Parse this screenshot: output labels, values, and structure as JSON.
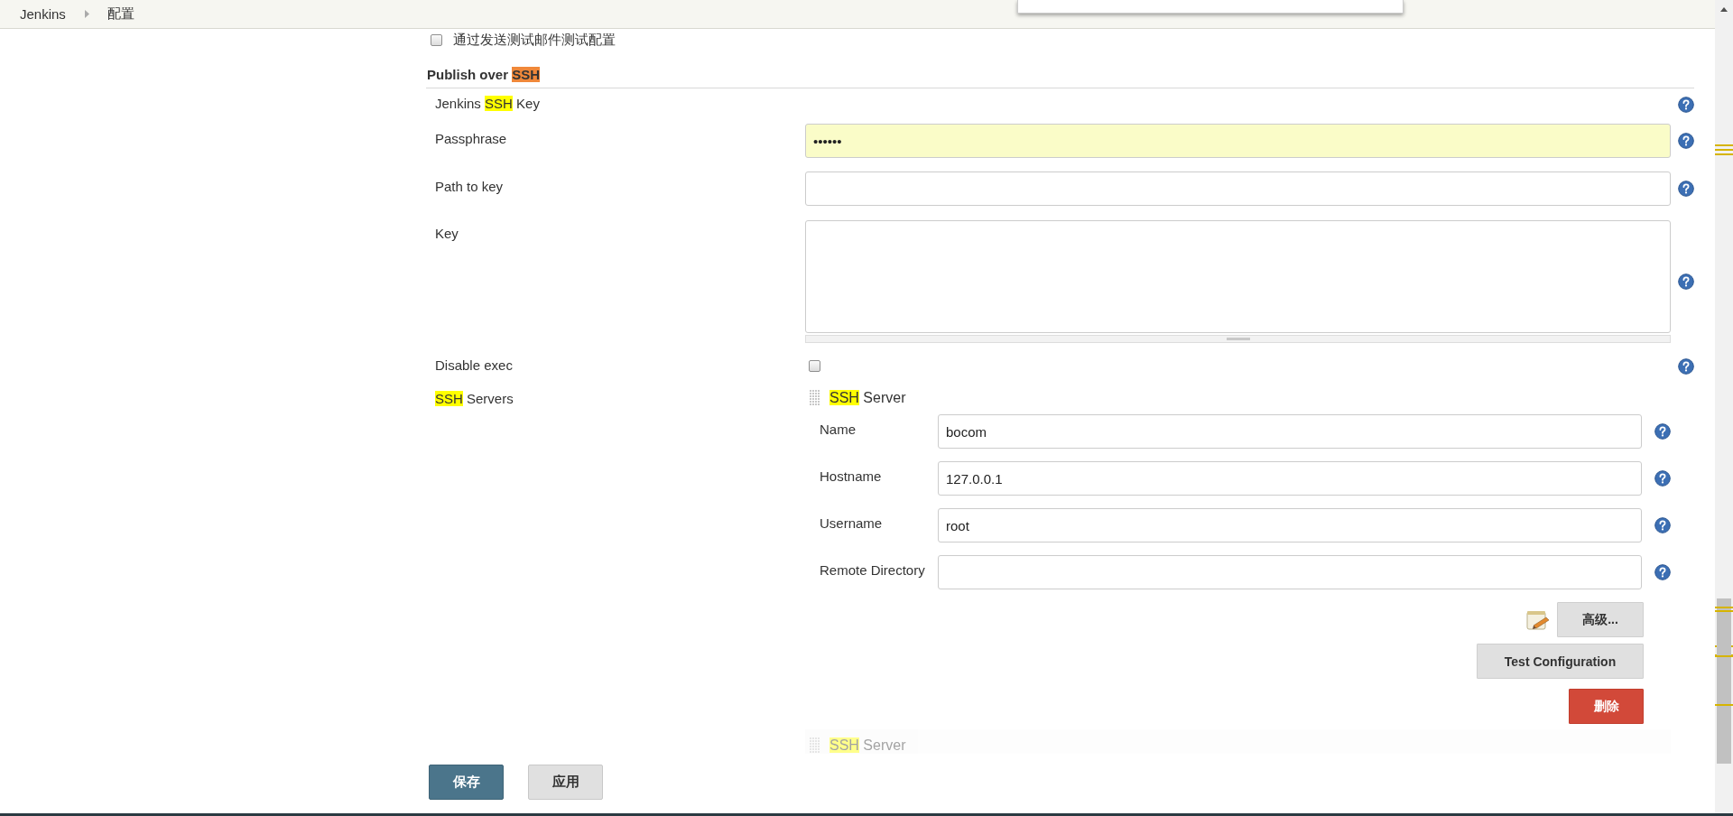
{
  "breadcrumbs": [
    {
      "label": "Jenkins"
    },
    {
      "label": "配置"
    }
  ],
  "test_mail": {
    "label": "通过发送测试邮件测试配置",
    "checked": false
  },
  "section": {
    "title": [
      {
        "text": "Publish over "
      },
      {
        "text": "SSH",
        "highlighted": true,
        "active": true
      }
    ]
  },
  "fields": [
    {
      "kind": "label",
      "label": [
        {
          "text": "Jenkins "
        },
        {
          "text": "SSH",
          "highlighted": true,
          "active": false
        },
        {
          "text": " Key"
        }
      ]
    },
    {
      "kind": "password",
      "label": [
        {
          "text": "Passphrase"
        }
      ],
      "value": "••••••",
      "autofilled": true
    },
    {
      "kind": "text",
      "label": [
        {
          "text": "Path to key"
        }
      ]
    },
    {
      "kind": "textarea",
      "label": [
        {
          "text": "Key"
        }
      ]
    },
    {
      "kind": "checkbox",
      "label": [
        {
          "text": "Disable exec"
        }
      ],
      "checked": false
    }
  ],
  "ssh_servers": {
    "label": [
      {
        "text": "SSH",
        "highlighted": true,
        "active": false
      },
      {
        "text": " Servers"
      }
    ],
    "servers": [
      {
        "title": [
          {
            "text": "SSH",
            "highlighted": true,
            "active": false
          },
          {
            "text": " Server"
          }
        ],
        "dimmed": false,
        "fields": [
          {
            "label": "Name",
            "value": "bocom"
          },
          {
            "label": "Hostname",
            "value": "127.0.0.1"
          },
          {
            "label": "Username",
            "value": "root"
          },
          {
            "label": "Remote Directory"
          }
        ],
        "buttons": [
          {
            "kind": "advanced",
            "label": "高级..."
          },
          {
            "kind": "test",
            "label": "Test Configuration"
          },
          {
            "kind": "delete",
            "label": "删除"
          }
        ]
      },
      {
        "title": [
          {
            "text": "SSH",
            "highlighted": true,
            "active": false
          },
          {
            "text": " Server"
          }
        ],
        "dimmed": true
      }
    ]
  },
  "footer": [
    {
      "kind": "primary",
      "label": "保存"
    },
    {
      "kind": "secondary",
      "label": "应用"
    }
  ]
}
